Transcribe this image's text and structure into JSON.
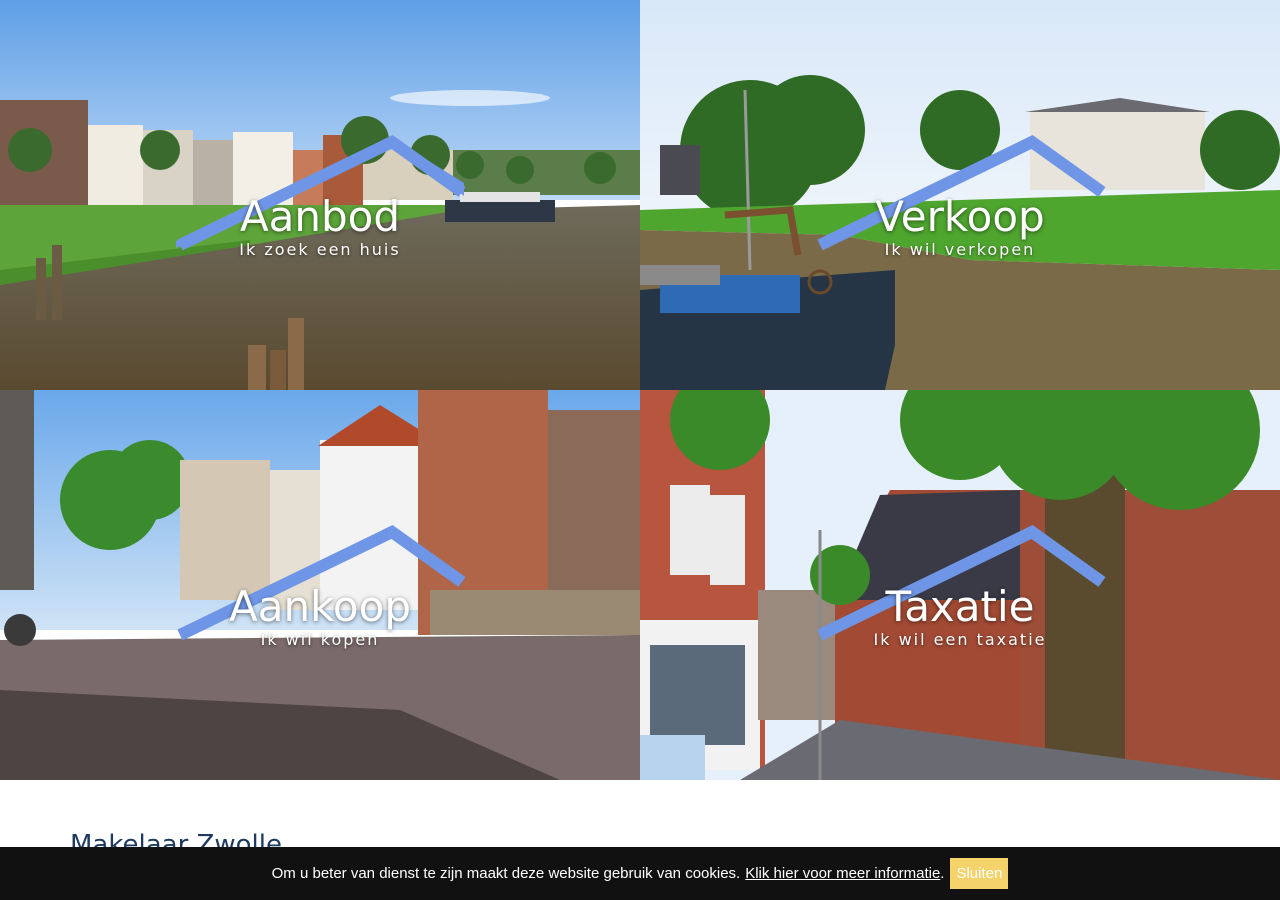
{
  "tiles": [
    {
      "title": "Aanbod",
      "subtitle": "Ik zoek een huis"
    },
    {
      "title": "Verkoop",
      "subtitle": "Ik wil verkopen"
    },
    {
      "title": "Aankoop",
      "subtitle": "Ik wil kopen"
    },
    {
      "title": "Taxatie",
      "subtitle": "Ik wil een taxatie"
    }
  ],
  "section": {
    "heading": "Makelaar Zwolle"
  },
  "cookie": {
    "message": "Om u beter van dienst te zijn maakt deze website gebruik van cookies.",
    "link_label": "Klik hier voor meer informatie",
    "dot": ".",
    "button_label": "Sluiten"
  },
  "colors": {
    "roof": "#6f96e6",
    "cookie_bg": "#111111",
    "cookie_button": "#f5d36a",
    "heading": "#1e3a5f"
  }
}
